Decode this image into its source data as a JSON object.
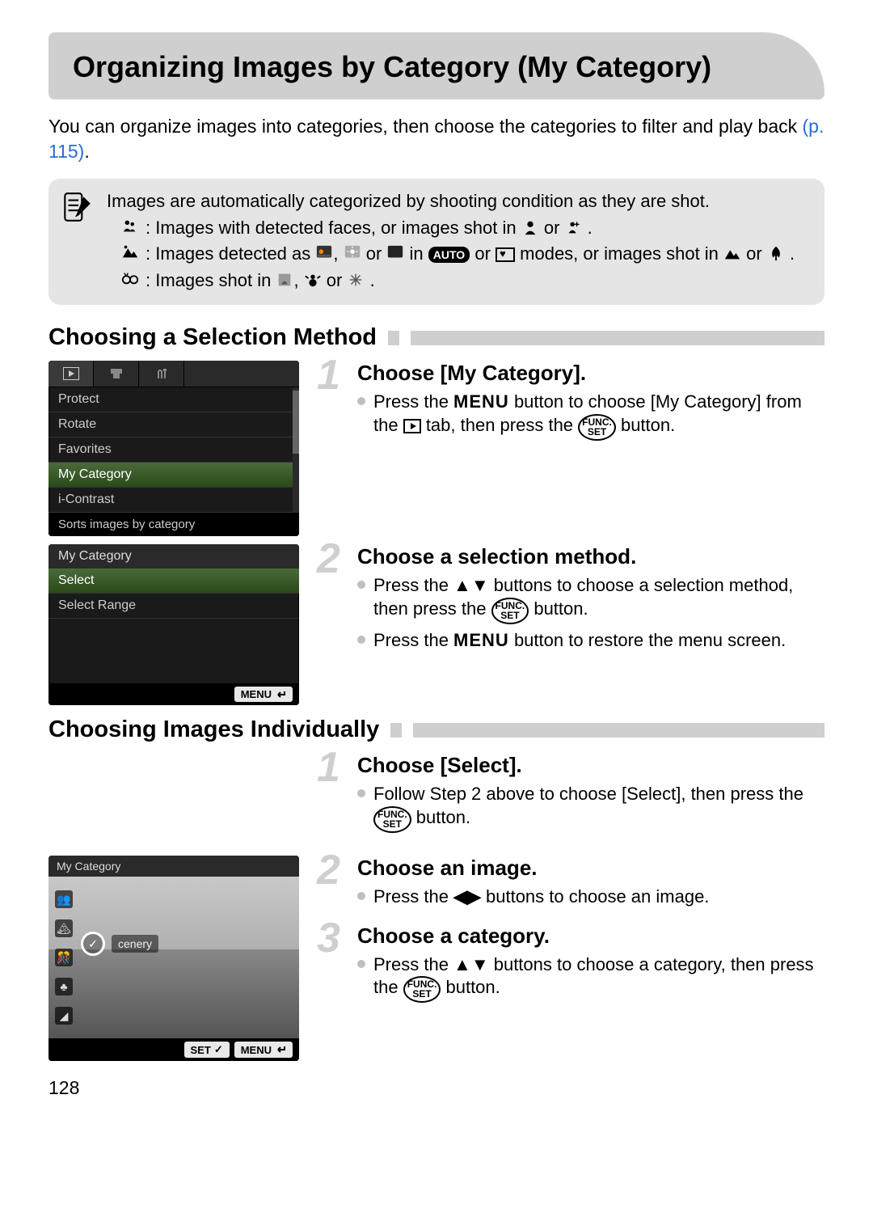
{
  "header": {
    "title": "Organizing Images by Category (My Category)"
  },
  "intro": {
    "text1": "You can organize images into categories, then choose the categories to filter and play back ",
    "pageref": "(p. 115)",
    "period": "."
  },
  "note": {
    "lead": "Images are automatically categorized by shooting condition as they are shot.",
    "items": [
      {
        "sym": "people-icon",
        "col": ":",
        "txt": "Images with detected faces, or images shot in ",
        "txt2": " or ",
        "txt3": "."
      },
      {
        "sym": "scenery-icon",
        "col": ":",
        "txt": "Images detected as ",
        "txt2": " in ",
        "txt3": " or ",
        "txt4": " modes, or images shot in ",
        "txt5": "or ",
        "txt6": "."
      },
      {
        "sym": "events-icon",
        "col": ":",
        "txt": "Images shot in ",
        "txt2": " or ",
        "txt3": "."
      }
    ]
  },
  "section1": {
    "title": "Choosing a Selection Method"
  },
  "section2": {
    "title": "Choosing Images Individually"
  },
  "screen1": {
    "items": [
      "Protect",
      "Rotate",
      "Favorites",
      "My Category",
      "i-Contrast"
    ],
    "status": "Sorts images by category"
  },
  "screen2": {
    "title": "My Category",
    "items": [
      "Select",
      "Select Range"
    ],
    "menu_badge": "MENU"
  },
  "screen3": {
    "title": "My Category",
    "label": "cenery",
    "set_badge": "SET",
    "menu_badge": "MENU"
  },
  "steps1": [
    {
      "num": "1",
      "title": "Choose [My Category].",
      "b1a": "Press the ",
      "b1_menu": "MENU",
      "b1b": " button to choose [My Category] from the ",
      "b1c": " tab, then press the ",
      "b1d": " button."
    },
    {
      "num": "2",
      "title": "Choose a selection method.",
      "b1a": "Press the ",
      "b1b": " buttons to choose a selection method, then press the ",
      "b1c": " button.",
      "b2a": "Press the ",
      "b2_menu": "MENU",
      "b2b": " button to restore the menu screen."
    }
  ],
  "steps2": [
    {
      "num": "1",
      "title": "Choose [Select].",
      "b1a": "Follow Step 2 above to choose [Select], then press the ",
      "b1b": " button."
    },
    {
      "num": "2",
      "title": "Choose an image.",
      "b1a": "Press the ",
      "b1b": " buttons to choose an image."
    },
    {
      "num": "3",
      "title": "Choose a category.",
      "b1a": "Press the ",
      "b1b": " buttons to choose a category, then press the ",
      "b1c": " button."
    }
  ],
  "page_num": "128"
}
